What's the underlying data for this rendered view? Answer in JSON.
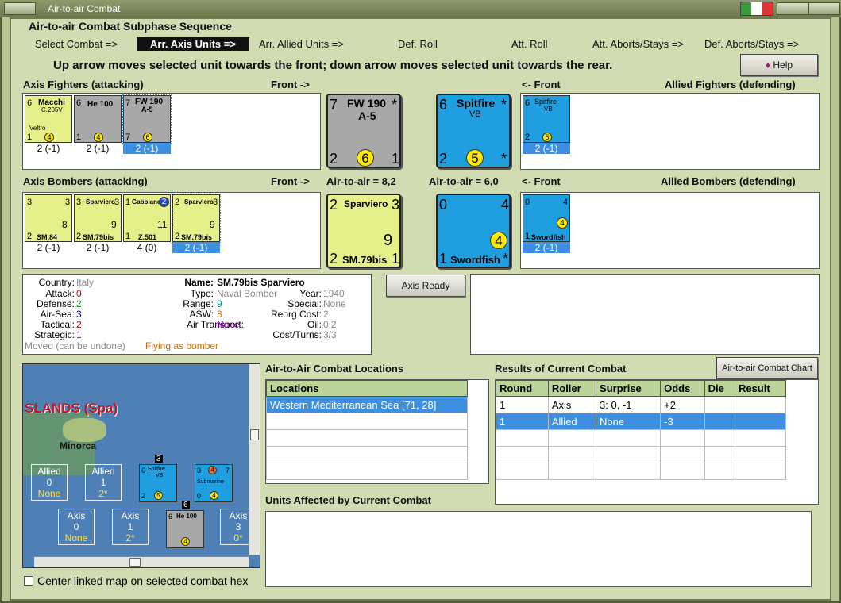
{
  "window": {
    "title": "Air-to-air Combat"
  },
  "sequence": {
    "title": "Air-to-air Combat Subphase Sequence",
    "steps": [
      "Select Combat =>",
      "Arr. Axis Units =>",
      "Arr. Allied Units =>",
      "Def. Roll",
      "Att. Roll",
      "Att. Aborts/Stays =>",
      "Def. Aborts/Stays =>"
    ]
  },
  "instruction": "Up arrow moves selected unit towards the front; down arrow moves selected unit towards the rear.",
  "help_label": "Help",
  "fighters": {
    "axis_title": "Axis Fighters (attacking)",
    "front_axis": "Front ->",
    "front_allied": "<- Front",
    "allied_title": "Allied Fighters (defending)",
    "axis_units": [
      {
        "name": "Macchi",
        "sub": "C.205V",
        "sub2": "Veltro",
        "att": "6",
        "def": "4",
        "range": "1",
        "label": "2 (-1)"
      },
      {
        "name": "He 100",
        "sub": "",
        "sub2": "",
        "att": "6",
        "def": "4",
        "range": "1",
        "label": "2 (-1)"
      },
      {
        "name": "FW 190",
        "sub": "A-5",
        "sub2": "",
        "att": "7",
        "def": "6",
        "range": "1",
        "label": "2 (-1)"
      }
    ],
    "axis_big": {
      "name": "FW 190",
      "sub": "A-5",
      "att": "7",
      "def": "6",
      "tl": "2",
      "tr": "1"
    },
    "allied_big": {
      "name": "Spitfire",
      "sub": "VB",
      "att": "6",
      "def": "5",
      "tl": "2"
    },
    "allied_units": [
      {
        "name": "Spitfire",
        "sub": "VB",
        "att": "6",
        "def": "5",
        "range": "2",
        "label": "2 (-1)"
      }
    ]
  },
  "bombers": {
    "axis_title": "Axis Bombers (attacking)",
    "front_axis": "Front ->",
    "axis_a2a": "Air-to-air = 8,2",
    "allied_a2a": "Air-to-air = 6,0",
    "front_allied": "<- Front",
    "allied_title": "Allied Bombers (defending)",
    "axis_units": [
      {
        "name": "",
        "sub": "SM.84",
        "att": "3",
        "def": "8",
        "tl": "3",
        "range": "2",
        "label": "2 (-1)"
      },
      {
        "name": "Sparviero",
        "sub": "SM.79bis",
        "att": "3",
        "def": "9",
        "tl": "3",
        "range": "2",
        "label": "2 (-1)"
      },
      {
        "name": "Gabbiano",
        "sub": "Z.501",
        "att": "1",
        "def": "11",
        "tl": "2",
        "range": "1",
        "label": "4 (0)"
      },
      {
        "name": "Sparviero",
        "sub": "SM.79bis",
        "att": "2",
        "def": "9",
        "tl": "3",
        "range": "2",
        "label": "2 (-1)"
      }
    ],
    "axis_big": {
      "name": "Sparviero",
      "sub": "SM.79bis",
      "att": "2",
      "def": "9",
      "tl": "3",
      "bl": "2",
      "br": "1"
    },
    "allied_big": {
      "name": "Swordfish",
      "att": "0",
      "def": "4",
      "tr": "4",
      "bl": "1"
    },
    "allied_units": [
      {
        "name": "Swordfish",
        "att": "0",
        "def": "4",
        "tr": "4",
        "bl": "1",
        "label": "2 (-1)"
      }
    ]
  },
  "unit_info": {
    "country_label": "Country:",
    "country": "Italy",
    "attack_label": "Attack:",
    "attack": "0",
    "defense_label": "Defense:",
    "defense": "2",
    "airsea_label": "Air-Sea:",
    "airsea": "3",
    "tactical_label": "Tactical:",
    "tactical": "2",
    "strategic_label": "Strategic:",
    "strategic": "1",
    "moved": "Moved (can be undone)",
    "flying": "Flying as bomber",
    "name_label": "Name:",
    "name": "SM.79bis Sparviero",
    "type_label": "Type:",
    "type": "Naval Bomber",
    "year_label": "Year:",
    "year": "1940",
    "range_label": "Range:",
    "range": "9",
    "special_label": "Special:",
    "special": "None",
    "asw_label": "ASW:",
    "asw": "3",
    "reorg_label": "Reorg Cost:",
    "reorg": "2",
    "air_transport_label": "Air Transport:",
    "air_transport": "None",
    "oil_label": "Oil:",
    "oil": "0,2",
    "cost_label": "Cost/Turns:",
    "cost": "3/3"
  },
  "axis_ready_label": "Axis Ready",
  "locations": {
    "title": "Air-to-Air Combat Locations",
    "header": "Locations",
    "rows": [
      "Western Mediterranean Sea [71, 28]"
    ]
  },
  "results": {
    "title": "Results of Current Combat",
    "chart_button": "Air-to-air Combat Chart",
    "columns": [
      "Round",
      "Roller",
      "Surprise",
      "Odds",
      "Die",
      "Result"
    ],
    "rows": [
      [
        "1",
        "Axis",
        "3: 0, -1",
        "+2",
        "",
        ""
      ],
      [
        "1",
        "Allied",
        "None",
        "-3",
        "",
        ""
      ]
    ]
  },
  "affected_title": "Units Affected by Current Combat",
  "map": {
    "region": "SLANDS (Spa)",
    "island": "Minorca",
    "allied_boxes": [
      {
        "side": "Allied",
        "num": "0",
        "extra": "None"
      },
      {
        "side": "Allied",
        "num": "1",
        "extra": "2*"
      }
    ],
    "axis_boxes": [
      {
        "side": "Axis",
        "num": "0",
        "extra": "None"
      },
      {
        "side": "Axis",
        "num": "1",
        "extra": "2*"
      },
      {
        "side": "Axis",
        "num": "3",
        "extra": "0*"
      }
    ],
    "stack_counts": [
      "3",
      "6"
    ],
    "spit_name": "Spitfire",
    "spit_sub": "VB",
    "spit_att": "6",
    "spit_def": "5",
    "spit_range": "2",
    "sub_name": "Submarine",
    "sub_att": "3",
    "sub_def": "4",
    "sub_mid": "4",
    "sub_tr": "7",
    "sub_bl": "0",
    "he_name": "He 100",
    "he_att": "6",
    "he_def": "4"
  },
  "center_map_label": "Center linked map on selected combat hex"
}
